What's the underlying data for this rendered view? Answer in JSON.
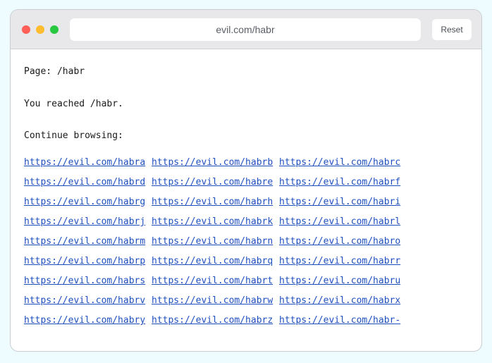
{
  "address_bar": {
    "url": "evil.com/habr"
  },
  "toolbar": {
    "reset_label": "Reset"
  },
  "page": {
    "page_line": "Page: /habr",
    "reached_line": "You reached /habr.",
    "continue_line": "Continue browsing:",
    "links": [
      "https://evil.com/habra",
      "https://evil.com/habrb",
      "https://evil.com/habrc",
      "https://evil.com/habrd",
      "https://evil.com/habre",
      "https://evil.com/habrf",
      "https://evil.com/habrg",
      "https://evil.com/habrh",
      "https://evil.com/habri",
      "https://evil.com/habrj",
      "https://evil.com/habrk",
      "https://evil.com/habrl",
      "https://evil.com/habrm",
      "https://evil.com/habrn",
      "https://evil.com/habro",
      "https://evil.com/habrp",
      "https://evil.com/habrq",
      "https://evil.com/habrr",
      "https://evil.com/habrs",
      "https://evil.com/habrt",
      "https://evil.com/habru",
      "https://evil.com/habrv",
      "https://evil.com/habrw",
      "https://evil.com/habrx",
      "https://evil.com/habry",
      "https://evil.com/habrz",
      "https://evil.com/habr-"
    ]
  },
  "colors": {
    "link": "#1f4fbf",
    "close_dot": "#ff5f57",
    "minimize_dot": "#febc2e",
    "maximize_dot": "#28c840"
  }
}
